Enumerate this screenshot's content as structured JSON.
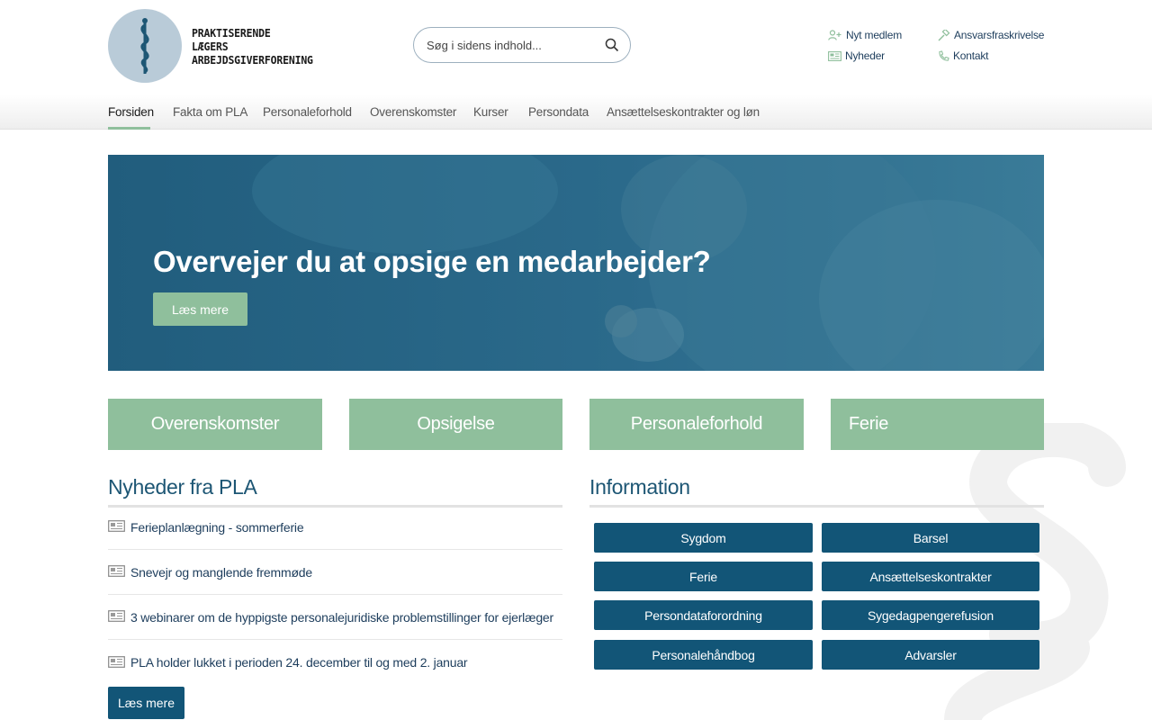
{
  "logo": {
    "lines": [
      "PRAKTISERENDE",
      "LÆGERS",
      "ARBEJDSGIVERFORENING"
    ]
  },
  "search": {
    "placeholder": "Søg i sidens indhold..."
  },
  "utility_links": [
    {
      "label": "Nyt medlem",
      "icon": "add-user-icon"
    },
    {
      "label": "Ansvarsfraskrivelse",
      "icon": "gavel-icon"
    },
    {
      "label": "Nyheder",
      "icon": "newspaper-icon"
    },
    {
      "label": "Kontakt",
      "icon": "phone-icon"
    }
  ],
  "nav": {
    "items": [
      {
        "label": "Forsiden",
        "active": true
      },
      {
        "label": "Fakta om PLA"
      },
      {
        "label": "Personaleforhold"
      },
      {
        "label": "Overenskomster"
      },
      {
        "label": "Kurser"
      },
      {
        "label": "Persondata"
      },
      {
        "label": "Ansættelseskontrakter og løn"
      }
    ]
  },
  "hero": {
    "title": "Overvejer du at opsige en medarbejder?",
    "button": "Læs mere"
  },
  "tiles": [
    "Overenskomster",
    "Opsigelse",
    "Personaleforhold",
    "Ferie"
  ],
  "news": {
    "title": "Nyheder fra PLA",
    "items": [
      "Ferieplanlægning - sommerferie",
      "Snevejr og manglende fremmøde",
      "3 webinarer om de hyppigste personalejuridiske problemstillinger for ejerlæger",
      "PLA holder lukket i perioden 24. december til og med 2. januar"
    ],
    "more": "Læs mere"
  },
  "info": {
    "title": "Information",
    "buttons": [
      "Sygdom",
      "Barsel",
      "Ferie",
      "Ansættelseskontrakter",
      "Persondataforordning",
      "Sygedagpengerefusion",
      "Personalehåndbog",
      "Advarsler"
    ]
  },
  "colors": {
    "primary": "#125577",
    "accent": "#8fbf9c",
    "hero": "#2b6a8b"
  }
}
